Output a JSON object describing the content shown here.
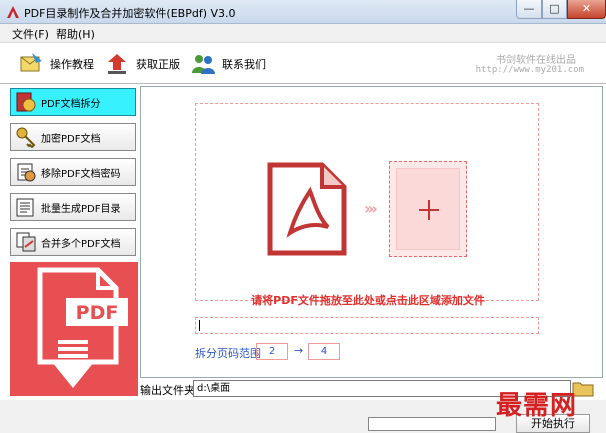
{
  "window": {
    "title": "PDF目录制作及合并加密软件(EBPdf) V3.0",
    "minimize_glyph": "—",
    "maximize_glyph": "□",
    "close_glyph": "✕"
  },
  "menu": {
    "items": [
      {
        "label": "文件(F)"
      },
      {
        "label": "帮助(H)"
      }
    ]
  },
  "toolbar": {
    "buttons": [
      {
        "label": "操作教程",
        "icon": "tutorial-icon"
      },
      {
        "label": "获取正版",
        "icon": "buy-icon"
      },
      {
        "label": "联系我们",
        "icon": "contact-icon"
      }
    ],
    "brand_name": "书剑软件在线出品",
    "brand_url": "http://www.my201.com"
  },
  "sidebar": {
    "items": [
      {
        "label": "PDF文档拆分",
        "active": true,
        "icon": "split-icon"
      },
      {
        "label": "加密PDF文档",
        "active": false,
        "icon": "key-icon"
      },
      {
        "label": "移除PDF文档密码",
        "active": false,
        "icon": "unlock-icon"
      },
      {
        "label": "批量生成PDF目录",
        "active": false,
        "icon": "toc-icon"
      },
      {
        "label": "合并多个PDF文档",
        "active": false,
        "icon": "merge-icon"
      }
    ],
    "promo_text": "PDF",
    "promo_color": "#e84f52"
  },
  "main": {
    "dropzone_hint": "请将PDF文件拖放至此处或点击此区域添加文件",
    "file_path_value": "",
    "range_label": "拆分页码范围",
    "range_from": "2",
    "range_to": "4",
    "range_arrow": "→"
  },
  "output": {
    "label": "输出文件夹",
    "value": "d:\\桌面"
  },
  "status": {
    "progress": 0,
    "start_button": "开始执行"
  },
  "watermark": "最需网",
  "colors": {
    "accent_red": "#e0302e",
    "active_tab": "#37f1ff",
    "link_blue": "#2a55c9"
  }
}
